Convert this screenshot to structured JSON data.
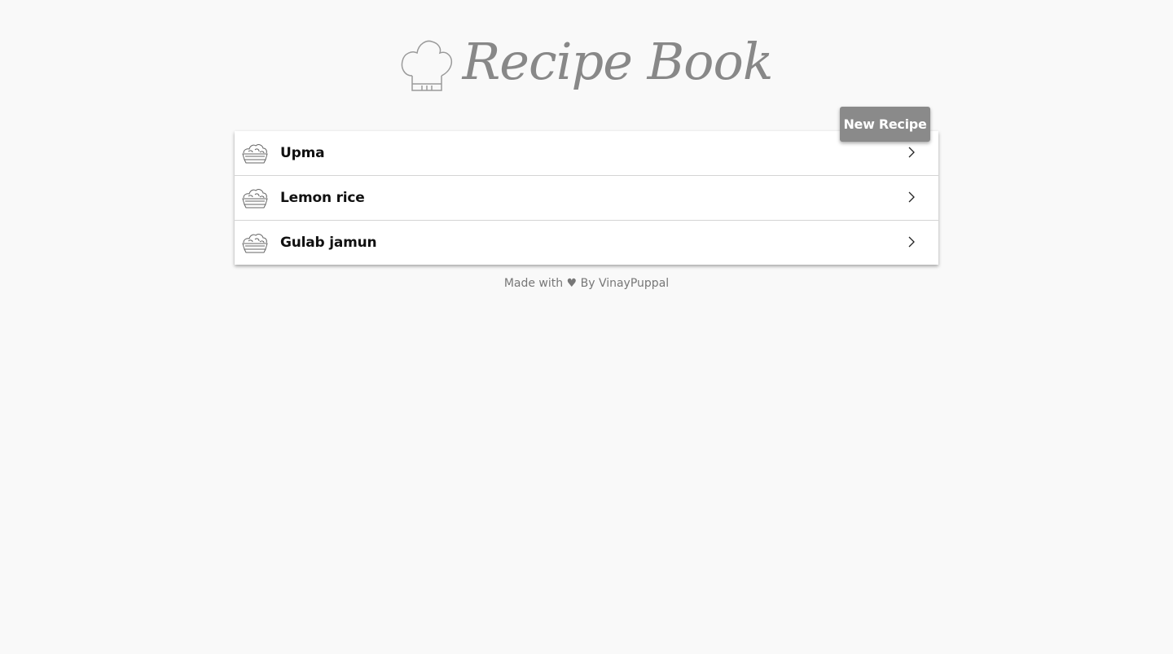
{
  "header": {
    "title": "Recipe Book",
    "logo_icon": "chef-hat-icon"
  },
  "toolbar": {
    "new_recipe_label": "New Recipe"
  },
  "recipes": [
    {
      "name": "Upma",
      "icon": "food-bowl-icon"
    },
    {
      "name": "Lemon rice",
      "icon": "food-bowl-icon"
    },
    {
      "name": "Gulab jamun",
      "icon": "food-bowl-icon"
    }
  ],
  "footer": {
    "prefix": "Made with",
    "heart": "♥",
    "suffix": "By VinayPuppal"
  },
  "colors": {
    "background": "#f9f9f9",
    "title": "#888888",
    "button_bg": "#8a8a8a",
    "button_text": "#ffffff",
    "row_text": "#111111",
    "footer_text": "#777777"
  }
}
